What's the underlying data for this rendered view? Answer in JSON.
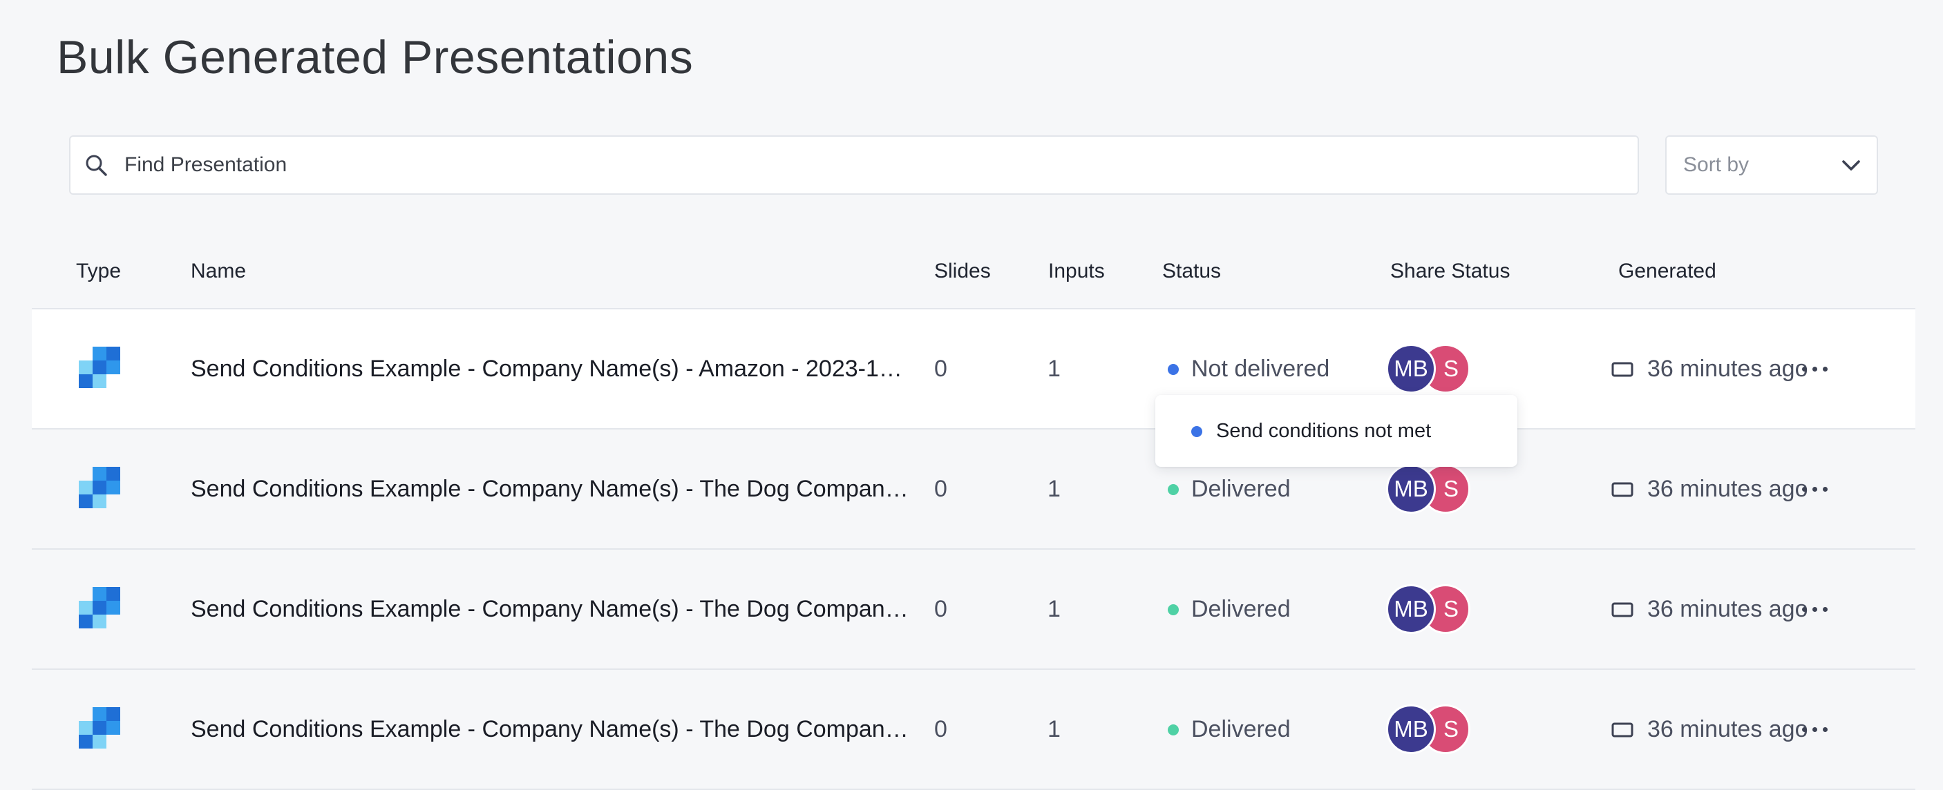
{
  "page": {
    "title": "Bulk Generated Presentations"
  },
  "search": {
    "placeholder": "Find Presentation",
    "value": "",
    "icon": "search-icon"
  },
  "sort": {
    "label": "Sort by",
    "icon": "chevron-down-icon"
  },
  "table": {
    "columns": {
      "type": "Type",
      "name": "Name",
      "slides": "Slides",
      "inputs": "Inputs",
      "status": "Status",
      "share_status": "Share Status",
      "generated": "Generated"
    },
    "rows": [
      {
        "name": "Send Conditions Example - Company Name(s) - Amazon - 2023-1…",
        "slides": "0",
        "inputs": "1",
        "status": "Not delivered",
        "avatars": [
          "MB",
          "S"
        ],
        "generated": "36 minutes ago"
      },
      {
        "name": "Send Conditions Example - Company Name(s) - The Dog Compan…",
        "slides": "0",
        "inputs": "1",
        "status": "Delivered",
        "avatars": [
          "MB",
          "S"
        ],
        "generated": "36 minutes ago"
      },
      {
        "name": "Send Conditions Example - Company Name(s) - The Dog Compan…",
        "slides": "0",
        "inputs": "1",
        "status": "Delivered",
        "avatars": [
          "MB",
          "S"
        ],
        "generated": "36 minutes ago"
      },
      {
        "name": "Send Conditions Example - Company Name(s) - The Dog Compan…",
        "slides": "0",
        "inputs": "1",
        "status": "Delivered",
        "avatars": [
          "MB",
          "S"
        ],
        "generated": "36 minutes ago"
      }
    ]
  },
  "tooltip": {
    "text": "Send conditions not met"
  },
  "icons": {
    "type": "presentation-type-icon",
    "generated": "presentation-screen-icon",
    "more": "more-horizontal-icon"
  },
  "colors": {
    "not_delivered": "#3b73e6",
    "delivered": "#4fd1a5",
    "avatar_mb": "#3c3a8f",
    "avatar_s": "#d94c75",
    "type_icon_dark": "#1f6fd6",
    "type_icon_mid": "#2f97ec",
    "type_icon_light": "#7fd3f6"
  }
}
